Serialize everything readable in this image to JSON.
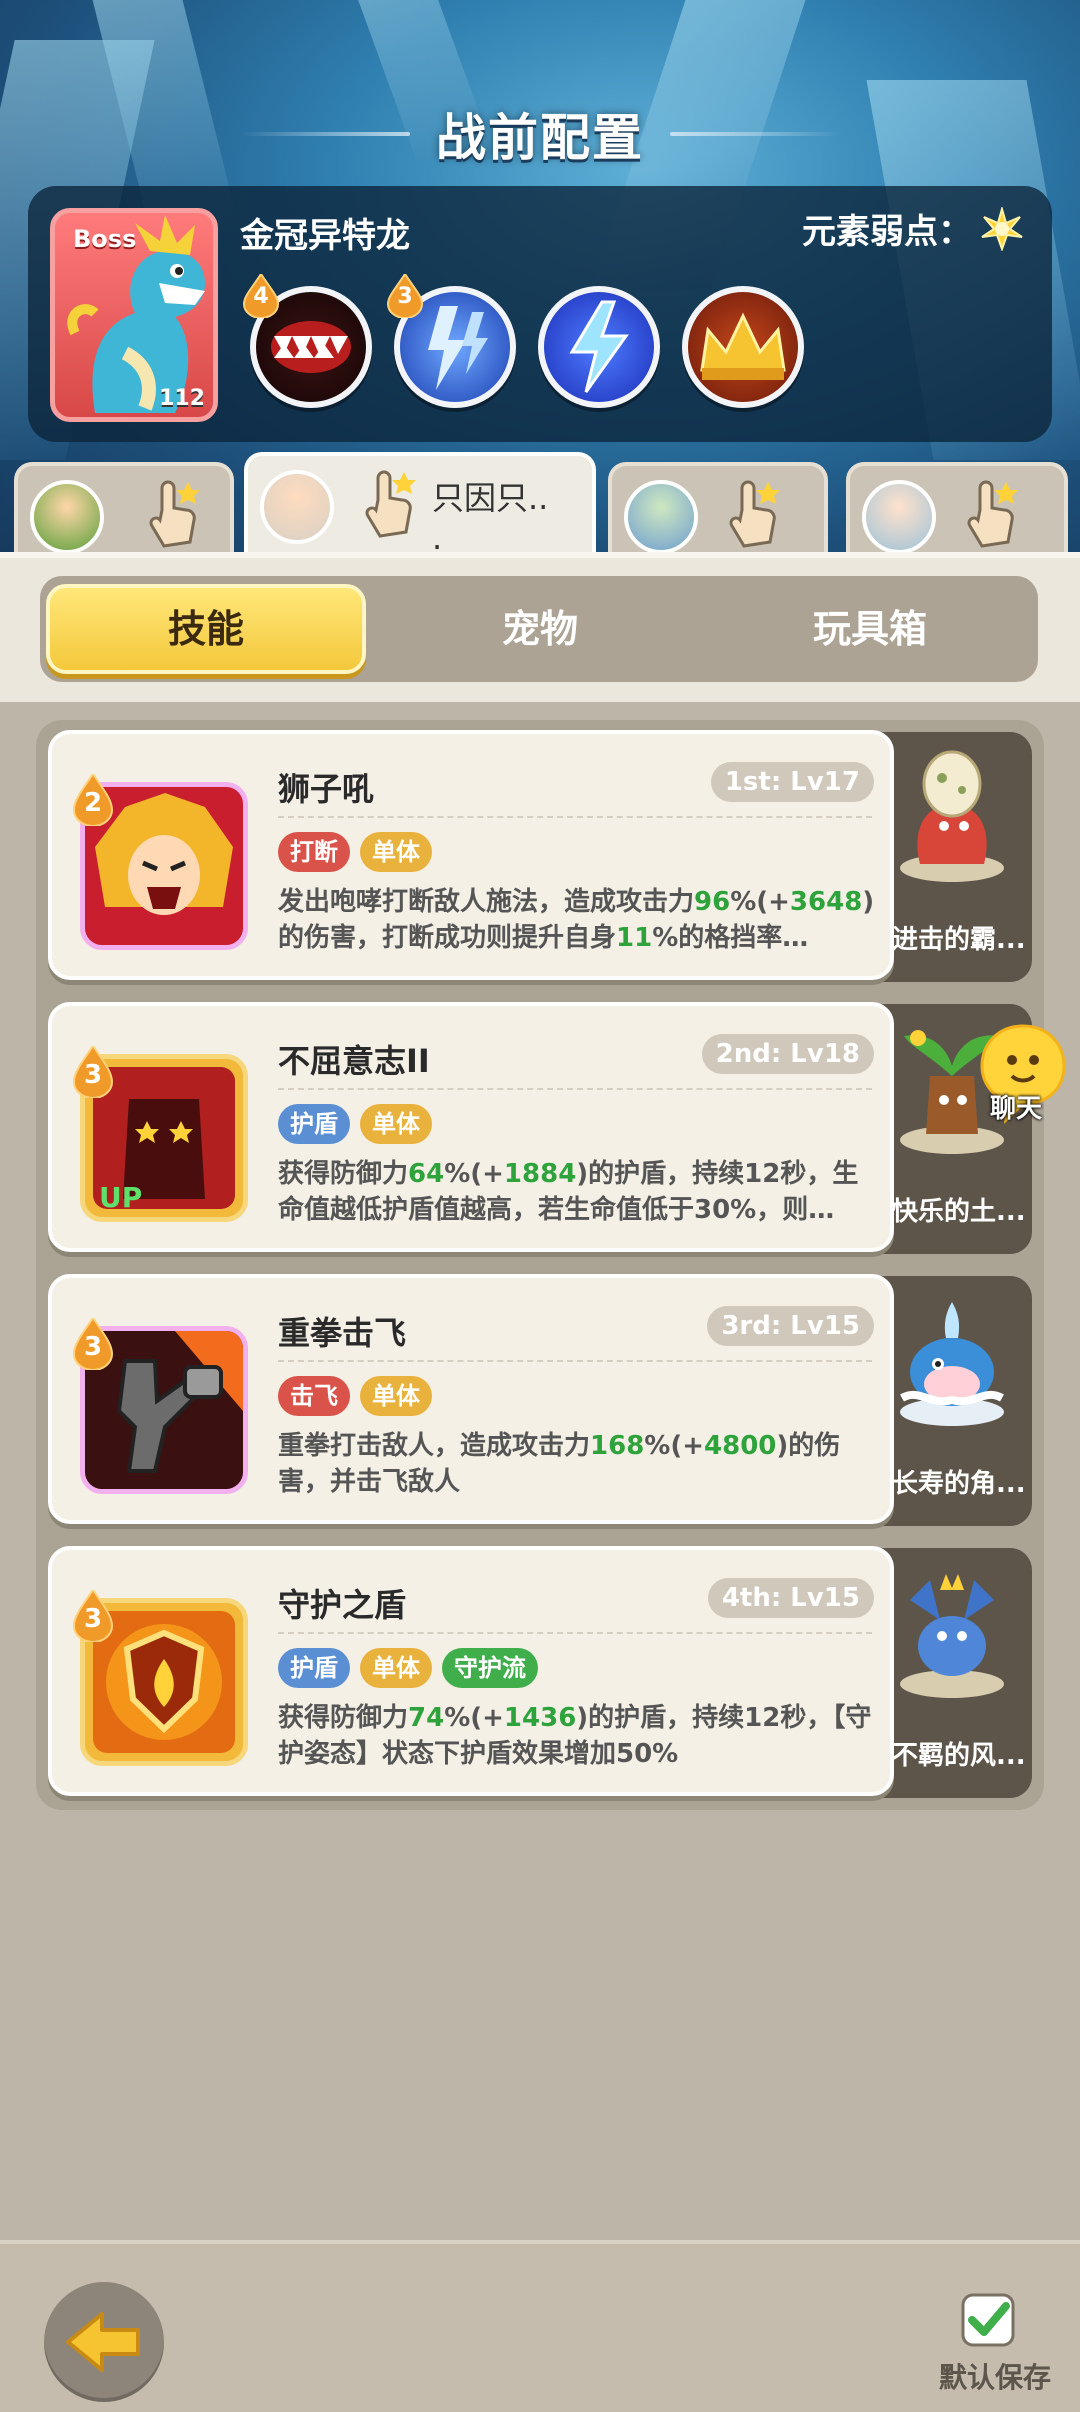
{
  "header": {
    "title": "战前配置"
  },
  "boss": {
    "tag": "Boss",
    "level": "112",
    "name": "金冠异特龙",
    "weakness_label": "元素弱点：",
    "skills": [
      {
        "icon": "fangs-icon",
        "badge": "4"
      },
      {
        "icon": "lightning-blue-icon",
        "badge": "3"
      },
      {
        "icon": "lightning-bolt-icon",
        "badge": ""
      },
      {
        "icon": "golden-crown-icon",
        "badge": ""
      }
    ]
  },
  "heroes": [
    {
      "label": ""
    },
    {
      "label": "只因只..\n."
    },
    {
      "label": ""
    },
    {
      "label": ""
    }
  ],
  "tabs": {
    "skills": "技能",
    "pets": "宠物",
    "toybox": "玩具箱",
    "active": "技能"
  },
  "skills": [
    {
      "badge": "2",
      "name": "狮子吼",
      "slot": "1st: Lv17",
      "tags": [
        "打断",
        "单体"
      ],
      "desc_parts": [
        "发出咆哮打断敌人施法，造成攻击力",
        "96",
        "%(+",
        "3648",
        ")的伤害，打断成功则提升自身",
        "11",
        "%的格挡率…"
      ],
      "pet": "进击的霸..."
    },
    {
      "badge": "3",
      "name": "不屈意志II",
      "slot": "2nd: Lv18",
      "tags": [
        "护盾",
        "单体"
      ],
      "desc_parts": [
        "获得防御力",
        "64",
        "%(+",
        "1884",
        ")的护盾，持续12秒，生命值越低护盾值越高，若生命值低于30%，则…"
      ],
      "pet": "快乐的土..."
    },
    {
      "badge": "3",
      "name": "重拳击飞",
      "slot": "3rd: Lv15",
      "tags": [
        "击飞",
        "单体"
      ],
      "desc_parts": [
        "重拳打击敌人，造成攻击力",
        "168",
        "%(+",
        "4800",
        ")的伤害，并击飞敌人"
      ],
      "pet": "长寿的角..."
    },
    {
      "badge": "3",
      "name": "守护之盾",
      "slot": "4th: Lv15",
      "tags": [
        "护盾",
        "单体",
        "守护流"
      ],
      "desc_parts": [
        "获得防御力",
        "74",
        "%(+",
        "1436",
        ")的护盾，持续12秒，【守护姿态】状态下护盾效果增加50%"
      ],
      "pet": "不羁的风..."
    }
  ],
  "chat": {
    "label": "聊天"
  },
  "footer": {
    "save_label": "默认保存"
  },
  "colors": {
    "accent_yellow": "#f4c83b",
    "value_green": "#2ea33b",
    "tag_red": "#d9534a",
    "tag_yellow": "#e9b23c",
    "tag_blue": "#5b8fd4",
    "tag_green": "#3fae4b"
  }
}
